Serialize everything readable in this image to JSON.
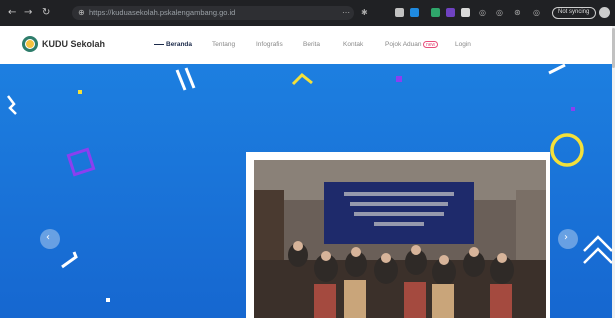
{
  "browser": {
    "url": "https://kuduasekolah.pskalengambang.go.id",
    "back_icon": "back-arrow-icon",
    "forward_icon": "forward-arrow-icon",
    "reload_icon": "reload-icon",
    "profile_pill": "Not syncing"
  },
  "header": {
    "brand": "KUDU Sekolah",
    "menu": [
      {
        "label": "Beranda",
        "active": true
      },
      {
        "label": "Tentang",
        "active": false
      },
      {
        "label": "Infografis",
        "active": false
      },
      {
        "label": "Berita",
        "active": false
      },
      {
        "label": "Kontak",
        "active": false
      },
      {
        "label": "Pojok Aduan",
        "active": false
      },
      {
        "label": "Login",
        "active": false
      }
    ],
    "badge": "new"
  },
  "hero": {
    "background": "#1d7fe0",
    "prev_icon": "chevron-left-icon",
    "next_icon": "chevron-right-icon"
  },
  "colors": {
    "accent_yellow": "#f3e03a",
    "accent_purple": "#8b3ff0",
    "brand_green": "#2e7d6b"
  }
}
